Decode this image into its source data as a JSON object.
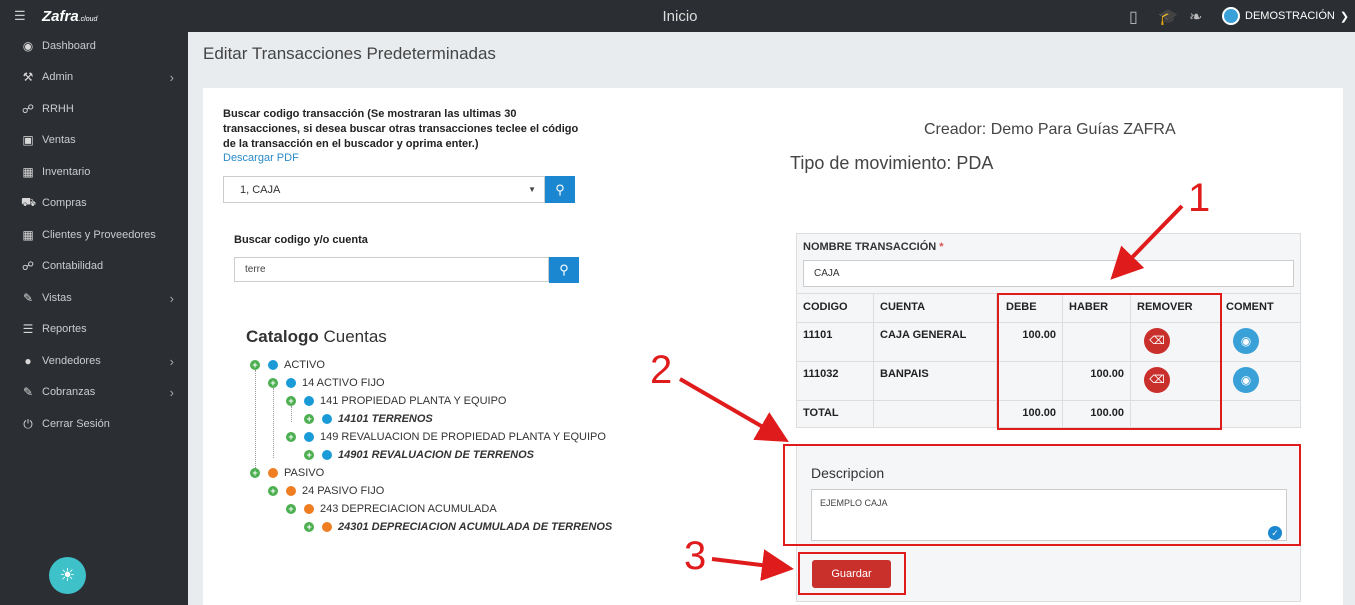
{
  "topbar": {
    "menu_icon": "hamburger-icon",
    "logo": "Zafra",
    "logo_suffix": ".cloud",
    "title": "Inicio",
    "user": "DEMOSTRACIÓN"
  },
  "sidebar": {
    "items": [
      {
        "label": "Dashboard",
        "icon": "dashboard-icon"
      },
      {
        "label": "Admin",
        "icon": "wrench-icon",
        "has_children": true
      },
      {
        "label": "RRHH",
        "icon": "paperclip-icon"
      },
      {
        "label": "Ventas",
        "icon": "money-icon"
      },
      {
        "label": "Inventario",
        "icon": "book-icon"
      },
      {
        "label": "Compras",
        "icon": "cart-icon"
      },
      {
        "label": "Clientes y Proveedores",
        "icon": "book-icon"
      },
      {
        "label": "Contabilidad",
        "icon": "paperclip-icon"
      },
      {
        "label": "Vistas",
        "icon": "edit-icon",
        "has_children": true
      },
      {
        "label": "Reportes",
        "icon": "list-icon"
      },
      {
        "label": "Vendedores",
        "icon": "user-icon",
        "has_children": true
      },
      {
        "label": "Cobranzas",
        "icon": "edit-icon",
        "has_children": true
      },
      {
        "label": "Cerrar Sesión",
        "icon": "power-icon"
      }
    ]
  },
  "page": {
    "title": "Editar Transacciones Predeterminadas"
  },
  "search": {
    "label_line1": "Buscar codigo transacción (Se mostraran las ultimas 30",
    "label_line2": "transacciones, si desea buscar otras transacciones teclee el código",
    "label_line3": "de la transacción en el buscador y oprima enter.)",
    "pdf_link": "Descargar PDF",
    "selected": "1, CAJA",
    "account_label": "Buscar codigo y/o cuenta",
    "account_value": "terre"
  },
  "catalog": {
    "title_bold": "Catalogo",
    "title_rest": "Cuentas",
    "nodes": [
      {
        "label": "ACTIVO",
        "color": "#1a9bd7"
      },
      {
        "label": "14 ACTIVO FIJO",
        "color": "#1a9bd7"
      },
      {
        "label": "141 PROPIEDAD PLANTA Y EQUIPO",
        "color": "#1a9bd7"
      },
      {
        "label": "14101 TERRENOS",
        "color": "#1a9bd7"
      },
      {
        "label": "149 REVALUACION DE PROPIEDAD PLANTA Y EQUIPO",
        "color": "#1a9bd7"
      },
      {
        "label": "14901 REVALUACION DE TERRENOS",
        "color": "#1a9bd7"
      },
      {
        "label": "PASIVO",
        "color": "#ef7d22"
      },
      {
        "label": "24 PASIVO FIJO",
        "color": "#ef7d22"
      },
      {
        "label": "243 DEPRECIACION ACUMULADA",
        "color": "#ef7d22"
      },
      {
        "label": "24301 DEPRECIACION ACUMULADA DE TERRENOS",
        "color": "#ef7d22"
      }
    ]
  },
  "info": {
    "creator": "Creador: Demo Para Guías ZAFRA",
    "tipo": "Tipo de movimiento: PDA"
  },
  "transaction": {
    "name_label": "NOMBRE TRANSACCIÓN",
    "required_mark": "*",
    "name_value": "CAJA",
    "headers": [
      "CODIGO",
      "CUENTA",
      "DEBE",
      "HABER",
      "REMOVER",
      "COMENT"
    ],
    "rows": [
      {
        "codigo": "11101",
        "cuenta": "CAJA GENERAL",
        "debe": "100.00",
        "haber": ""
      },
      {
        "codigo": "111032",
        "cuenta": "BANPAIS",
        "debe": "",
        "haber": "100.00"
      }
    ],
    "total_label": "TOTAL",
    "total_debe": "100.00",
    "total_haber": "100.00"
  },
  "description": {
    "label": "Descripcion",
    "value": "EJEMPLO CAJA"
  },
  "actions": {
    "save": "Guardar"
  },
  "annotations": {
    "n1": "1",
    "n2": "2",
    "n3": "3",
    "color": "#e01b1b"
  }
}
